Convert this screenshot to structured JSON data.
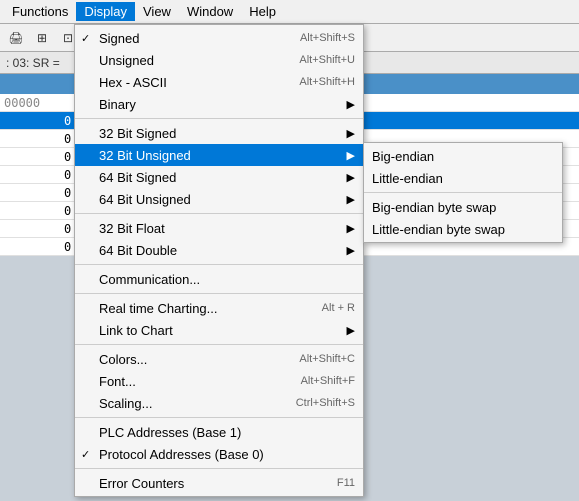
{
  "menubar": {
    "items": [
      {
        "label": "Functions"
      },
      {
        "label": "Display"
      },
      {
        "label": "View"
      },
      {
        "label": "Window"
      },
      {
        "label": "Help"
      }
    ],
    "active_index": 1
  },
  "toolbar": {
    "buttons": [
      "🖨",
      "⊞",
      "⊡"
    ]
  },
  "address_bar": {
    "text": ": 03: SR ="
  },
  "data_rows": [
    {
      "addr": "00000",
      "val": "",
      "selected": false
    },
    {
      "addr": "",
      "val": "0",
      "selected": true
    },
    {
      "addr": "",
      "val": "0",
      "selected": false
    },
    {
      "addr": "",
      "val": "0",
      "selected": false
    },
    {
      "addr": "",
      "val": "0",
      "selected": false
    },
    {
      "addr": "",
      "val": "0",
      "selected": false
    },
    {
      "addr": "",
      "val": "0",
      "selected": false
    },
    {
      "addr": "",
      "val": "0",
      "selected": false
    },
    {
      "addr": "",
      "val": "0",
      "selected": false
    }
  ],
  "dropdown": {
    "items": [
      {
        "label": "Signed",
        "shortcut": "Alt+Shift+S",
        "checked": true,
        "has_sub": false
      },
      {
        "label": "Unsigned",
        "shortcut": "Alt+Shift+U",
        "checked": false,
        "has_sub": false
      },
      {
        "label": "Hex - ASCII",
        "shortcut": "Alt+Shift+H",
        "checked": false,
        "has_sub": false
      },
      {
        "label": "Binary",
        "shortcut": "",
        "checked": false,
        "has_sub": true
      },
      {
        "divider": true
      },
      {
        "label": "32 Bit Signed",
        "shortcut": "",
        "checked": false,
        "has_sub": true
      },
      {
        "label": "32 Bit Unsigned",
        "shortcut": "",
        "checked": false,
        "has_sub": true,
        "highlighted": true
      },
      {
        "label": "64 Bit Signed",
        "shortcut": "",
        "checked": false,
        "has_sub": true
      },
      {
        "label": "64 Bit Unsigned",
        "shortcut": "",
        "checked": false,
        "has_sub": true
      },
      {
        "divider2": true
      },
      {
        "label": "32 Bit Float",
        "shortcut": "",
        "checked": false,
        "has_sub": true
      },
      {
        "label": "64 Bit Double",
        "shortcut": "",
        "checked": false,
        "has_sub": true
      },
      {
        "divider3": true
      },
      {
        "label": "Communication...",
        "shortcut": "",
        "checked": false,
        "has_sub": false
      },
      {
        "divider4": true
      },
      {
        "label": "Real time Charting...",
        "shortcut": "Alt + R",
        "checked": false,
        "has_sub": false
      },
      {
        "label": "Link to Chart",
        "shortcut": "",
        "checked": false,
        "has_sub": true
      },
      {
        "divider5": true
      },
      {
        "label": "Colors...",
        "shortcut": "Alt+Shift+C",
        "checked": false,
        "has_sub": false
      },
      {
        "label": "Font...",
        "shortcut": "Alt+Shift+F",
        "checked": false,
        "has_sub": false
      },
      {
        "label": "Scaling...",
        "shortcut": "Ctrl+Shift+S",
        "checked": false,
        "has_sub": false
      },
      {
        "divider6": true
      },
      {
        "label": "PLC Addresses (Base 1)",
        "shortcut": "",
        "checked": false,
        "has_sub": false
      },
      {
        "label": "Protocol Addresses (Base 0)",
        "shortcut": "",
        "checked": true,
        "has_sub": false
      },
      {
        "divider7": true
      },
      {
        "label": "Error Counters",
        "shortcut": "F11",
        "checked": false,
        "has_sub": false
      }
    ],
    "submenu": {
      "items": [
        {
          "label": "Big-endian"
        },
        {
          "label": "Little-endian"
        },
        {
          "divider": true
        },
        {
          "label": "Big-endian byte swap"
        },
        {
          "label": "Little-endian byte swap"
        }
      ]
    }
  }
}
